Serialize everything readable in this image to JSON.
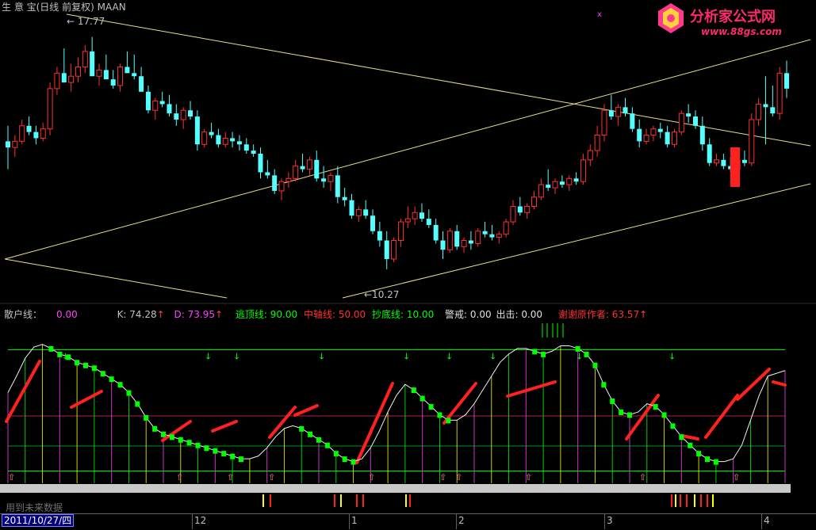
{
  "window": {
    "title": "生 意 宝(日线 前复权) MAAN",
    "future_data_label": "用到未来数据",
    "date_cursor": "2011/10/27/四"
  },
  "logo": {
    "name": "分析家公式网",
    "url_text": "www.88gs.com"
  },
  "price_panel": {
    "high_label": "17.77",
    "low_label": "10.27",
    "annot_arrow": "←"
  },
  "indicator_header": {
    "name_label": "散户线：",
    "name_value": "0.00",
    "k_label": "K: ",
    "k_value": "74.28",
    "d_label": "D: ",
    "d_value": "73.95",
    "top_label": "逃顶线: ",
    "top_value": "90.00",
    "mid_label": "中轴线: ",
    "mid_value": "50.00",
    "bottom_label": "抄底线: ",
    "bottom_value": "10.00",
    "warn_label": "警戒: ",
    "warn_value": "0.00",
    "exit_label": "出击: ",
    "exit_value": "0.00",
    "thanks_label": "谢谢原作者: ",
    "thanks_value": "63.57",
    "up_arrow": "↑"
  },
  "time_axis": {
    "ticks": [
      "12",
      "1",
      "2",
      "3",
      "4"
    ]
  },
  "colors": {
    "up": "#ff3030",
    "down": "#54ffff",
    "trend": "#e8e08a",
    "green": "#00ff00",
    "red_line": "#ff2020",
    "magenta": "#ff40ff",
    "yellow": "#ffff00"
  },
  "chart_data": [
    {
      "type": "candlestick",
      "title": "生 意 宝(日线 前复权) MAAN",
      "annotations": [
        "17.77",
        "10.27"
      ],
      "ylim": [
        9.5,
        18.5
      ],
      "candles": [
        [
          14.4,
          14.9,
          13.5,
          14.2
        ],
        [
          14.2,
          14.6,
          13.9,
          14.4
        ],
        [
          14.4,
          15.1,
          14.3,
          14.9
        ],
        [
          14.9,
          15.2,
          14.6,
          14.7
        ],
        [
          14.7,
          14.9,
          14.3,
          14.5
        ],
        [
          14.5,
          15.0,
          14.4,
          14.8
        ],
        [
          14.8,
          16.3,
          14.6,
          16.1
        ],
        [
          16.1,
          16.8,
          15.9,
          16.6
        ],
        [
          16.6,
          17.4,
          16.4,
          16.3
        ],
        [
          16.3,
          16.9,
          16.0,
          16.5
        ],
        [
          16.5,
          17.1,
          16.3,
          16.8
        ],
        [
          16.8,
          17.5,
          16.6,
          17.3
        ],
        [
          17.3,
          17.77,
          16.8,
          16.5
        ],
        [
          16.5,
          16.9,
          16.2,
          16.7
        ],
        [
          16.7,
          17.2,
          16.4,
          16.4
        ],
        [
          16.4,
          16.7,
          16.1,
          16.2
        ],
        [
          16.2,
          16.9,
          16.0,
          16.8
        ],
        [
          16.8,
          17.3,
          16.6,
          16.6
        ],
        [
          16.6,
          17.2,
          16.4,
          16.5
        ],
        [
          16.5,
          16.8,
          16.0,
          16.0
        ],
        [
          16.0,
          16.2,
          15.3,
          15.4
        ],
        [
          15.4,
          15.8,
          15.1,
          15.7
        ],
        [
          15.7,
          16.0,
          15.5,
          15.6
        ],
        [
          15.6,
          15.9,
          15.2,
          15.3
        ],
        [
          15.3,
          15.6,
          14.9,
          15.1
        ],
        [
          15.1,
          15.5,
          14.8,
          15.4
        ],
        [
          15.4,
          15.7,
          15.1,
          15.2
        ],
        [
          15.2,
          15.4,
          14.1,
          14.3
        ],
        [
          14.3,
          14.8,
          14.2,
          14.7
        ],
        [
          14.7,
          15.0,
          14.5,
          14.6
        ],
        [
          14.6,
          14.8,
          14.2,
          14.3
        ],
        [
          14.3,
          14.7,
          14.2,
          14.5
        ],
        [
          14.5,
          14.7,
          14.2,
          14.4
        ],
        [
          14.4,
          14.6,
          14.1,
          14.3
        ],
        [
          14.3,
          14.5,
          14.0,
          14.1
        ],
        [
          14.1,
          14.3,
          13.9,
          14.0
        ],
        [
          14.0,
          14.2,
          13.2,
          13.4
        ],
        [
          13.4,
          13.8,
          13.2,
          13.3
        ],
        [
          13.3,
          13.5,
          12.7,
          12.8
        ],
        [
          12.8,
          13.2,
          12.5,
          13.1
        ],
        [
          13.1,
          13.4,
          12.9,
          13.2
        ],
        [
          13.2,
          13.8,
          13.1,
          13.6
        ],
        [
          13.6,
          14.0,
          13.4,
          13.5
        ],
        [
          13.5,
          13.9,
          13.3,
          13.8
        ],
        [
          13.8,
          14.1,
          13.1,
          13.2
        ],
        [
          13.2,
          13.6,
          12.9,
          13.1
        ],
        [
          13.1,
          13.4,
          12.8,
          13.3
        ],
        [
          13.3,
          13.6,
          12.4,
          12.6
        ],
        [
          12.6,
          12.9,
          12.3,
          12.5
        ],
        [
          12.5,
          12.7,
          11.9,
          12.0
        ],
        [
          12.0,
          12.3,
          11.8,
          12.2
        ],
        [
          12.2,
          12.5,
          11.9,
          12.0
        ],
        [
          12.0,
          12.2,
          11.4,
          11.5
        ],
        [
          11.5,
          11.8,
          11.0,
          11.2
        ],
        [
          11.2,
          11.5,
          10.27,
          10.6
        ],
        [
          10.6,
          11.3,
          10.5,
          11.2
        ],
        [
          11.2,
          11.9,
          11.0,
          11.8
        ],
        [
          11.8,
          12.3,
          11.6,
          11.9
        ],
        [
          11.9,
          12.3,
          11.7,
          12.1
        ],
        [
          12.1,
          12.4,
          11.8,
          11.9
        ],
        [
          11.9,
          12.2,
          11.6,
          11.7
        ],
        [
          11.7,
          11.9,
          11.1,
          11.2
        ],
        [
          11.2,
          11.5,
          10.6,
          10.9
        ],
        [
          10.9,
          11.6,
          10.8,
          11.5
        ],
        [
          11.5,
          11.7,
          10.9,
          11.0
        ],
        [
          11.0,
          11.3,
          10.8,
          11.2
        ],
        [
          11.2,
          11.5,
          10.9,
          11.1
        ],
        [
          11.1,
          11.6,
          11.0,
          11.5
        ],
        [
          11.5,
          11.8,
          11.3,
          11.4
        ],
        [
          11.4,
          11.7,
          11.2,
          11.3
        ],
        [
          11.3,
          11.5,
          11.1,
          11.4
        ],
        [
          11.4,
          11.9,
          11.3,
          11.8
        ],
        [
          11.8,
          12.5,
          11.7,
          12.3
        ],
        [
          12.3,
          12.6,
          12.0,
          12.1
        ],
        [
          12.1,
          12.4,
          11.9,
          12.3
        ],
        [
          12.3,
          12.8,
          12.2,
          12.6
        ],
        [
          12.6,
          13.2,
          12.5,
          13.0
        ],
        [
          13.0,
          13.5,
          12.8,
          12.9
        ],
        [
          12.9,
          13.2,
          12.7,
          13.1
        ],
        [
          13.1,
          13.3,
          12.9,
          13.0
        ],
        [
          13.0,
          13.3,
          12.8,
          13.2
        ],
        [
          13.2,
          13.4,
          13.0,
          13.1
        ],
        [
          13.1,
          14.0,
          13.0,
          13.8
        ],
        [
          13.8,
          14.3,
          13.6,
          14.1
        ],
        [
          14.1,
          14.9,
          13.9,
          14.6
        ],
        [
          14.6,
          15.6,
          14.4,
          15.4
        ],
        [
          15.4,
          15.9,
          15.1,
          15.2
        ],
        [
          15.2,
          15.6,
          14.9,
          15.5
        ],
        [
          15.5,
          15.8,
          15.2,
          15.3
        ],
        [
          15.3,
          15.5,
          14.7,
          14.8
        ],
        [
          14.8,
          15.1,
          14.2,
          14.4
        ],
        [
          14.4,
          14.8,
          14.3,
          14.6
        ],
        [
          14.6,
          14.9,
          14.4,
          14.8
        ],
        [
          14.8,
          15.0,
          14.5,
          14.7
        ],
        [
          14.7,
          14.9,
          14.2,
          14.3
        ],
        [
          14.3,
          14.8,
          14.2,
          14.7
        ],
        [
          14.7,
          15.4,
          14.6,
          15.3
        ],
        [
          15.3,
          15.6,
          15.0,
          15.2
        ],
        [
          15.2,
          15.4,
          14.8,
          14.9
        ],
        [
          14.9,
          15.2,
          14.1,
          14.3
        ],
        [
          14.3,
          14.5,
          13.6,
          13.7
        ],
        [
          13.7,
          14.0,
          13.6,
          13.8
        ],
        [
          13.8,
          14.0,
          13.5,
          13.6
        ],
        [
          13.6,
          13.9,
          13.4,
          13.5
        ],
        [
          13.5,
          13.9,
          13.4,
          13.8
        ],
        [
          13.8,
          14.1,
          13.6,
          13.7
        ],
        [
          13.7,
          15.3,
          13.6,
          15.1
        ],
        [
          15.1,
          15.8,
          14.9,
          15.6
        ],
        [
          15.6,
          16.5,
          14.3,
          15.5
        ],
        [
          15.5,
          16.2,
          15.2,
          15.3
        ],
        [
          15.3,
          16.8,
          15.1,
          16.6
        ],
        [
          16.6,
          17.0,
          15.8,
          16.1
        ]
      ],
      "trend_lines": 4
    },
    {
      "type": "line",
      "series": [
        {
          "name": "K",
          "last": 74.28
        },
        {
          "name": "D",
          "last": 73.95
        },
        {
          "name": "逃顶线",
          "value": 90.0
        },
        {
          "name": "中轴线",
          "value": 50.0
        },
        {
          "name": "抄底线",
          "value": 10.0
        },
        {
          "name": "谢谢原作者",
          "last": 63.57
        }
      ],
      "ylim": [
        0,
        100
      ],
      "k_values": [
        60,
        72,
        85,
        93,
        95,
        92,
        88,
        86,
        82,
        80,
        78,
        74,
        70,
        66,
        60,
        52,
        42,
        34,
        30,
        28,
        26,
        24,
        22,
        20,
        18,
        16,
        14,
        12,
        12,
        14,
        20,
        28,
        34,
        36,
        34,
        30,
        26,
        22,
        16,
        12,
        10,
        12,
        20,
        32,
        46,
        58,
        66,
        62,
        56,
        50,
        44,
        40,
        40,
        44,
        52,
        62,
        72,
        82,
        88,
        92,
        92,
        90,
        88,
        90,
        94,
        94,
        92,
        88,
        80,
        66,
        54,
        46,
        44,
        46,
        52,
        50,
        44,
        36,
        28,
        22,
        16,
        12,
        10,
        10,
        12,
        22,
        40,
        58,
        72,
        74,
        76
      ]
    }
  ]
}
